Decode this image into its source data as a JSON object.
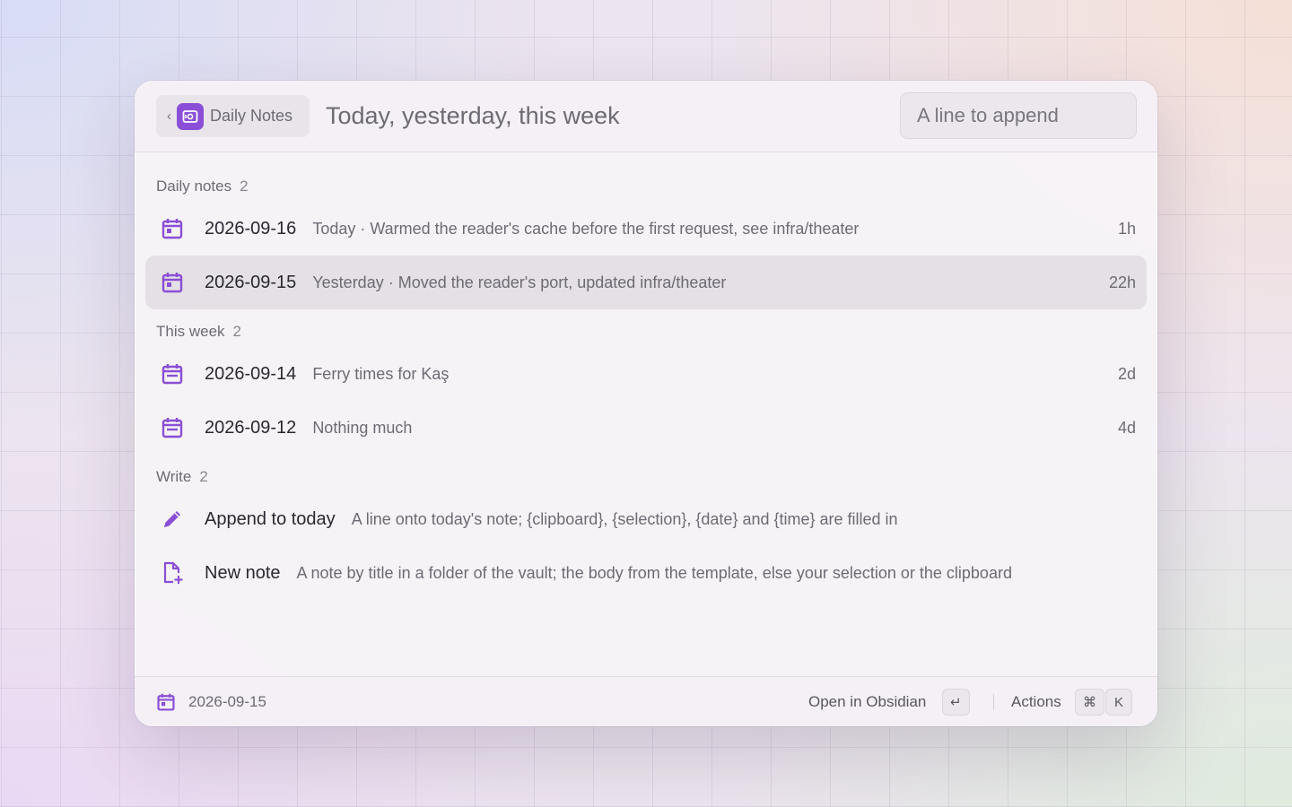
{
  "header": {
    "back_glyph": "‹",
    "extension_name": "Daily Notes",
    "search_text": "Today, yesterday, this week",
    "append_placeholder": "A line to append"
  },
  "sections": [
    {
      "title": "Daily notes",
      "count": "2",
      "items": [
        {
          "icon": "calendar-icon",
          "title": "2026-09-16",
          "subtitle": "Today · Warmed the reader's cache before the first request, see infra/theater",
          "age": "1h",
          "selected": false
        },
        {
          "icon": "calendar-icon",
          "title": "2026-09-15",
          "subtitle": "Yesterday · Moved the reader's port, updated infra/theater",
          "age": "22h",
          "selected": true
        }
      ]
    },
    {
      "title": "This week",
      "count": "2",
      "items": [
        {
          "icon": "calendar-icon",
          "title": "2026-09-14",
          "subtitle": "Ferry times for Kaş",
          "age": "2d"
        },
        {
          "icon": "calendar-icon",
          "title": "2026-09-12",
          "subtitle": "Nothing much",
          "age": "4d"
        }
      ]
    },
    {
      "title": "Write",
      "count": "2",
      "items": [
        {
          "icon": "pencil-icon",
          "title": "Append to today",
          "subtitle": "A line onto today's note; {clipboard}, {selection}, {date} and {time} are filled in"
        },
        {
          "icon": "new-file-icon",
          "title": "New note",
          "subtitle": "A note by title in a folder of the vault; the body from the template, else your selection or the clipboard"
        }
      ]
    }
  ],
  "footer": {
    "selected_item": "2026-09-15",
    "primary_action": "Open in Obsidian",
    "primary_key": "↵",
    "actions_label": "Actions",
    "actions_keys": [
      "⌘",
      "K"
    ]
  },
  "colors": {
    "accent": "#8a4fd6",
    "selected_row": "#e4e0e5"
  }
}
